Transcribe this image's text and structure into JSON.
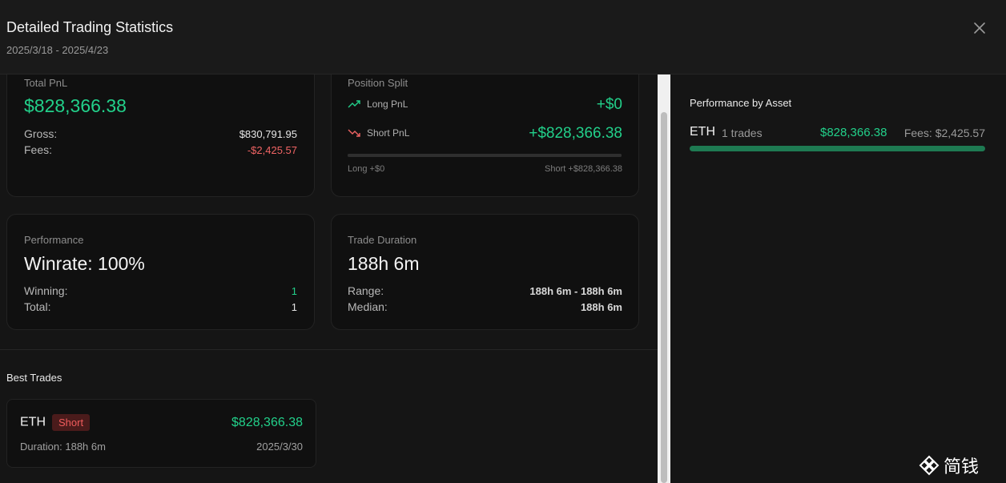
{
  "header": {
    "title": "Detailed Trading Statistics",
    "date_range": "2025/3/18 - 2025/4/23"
  },
  "total_pnl": {
    "label": "Total PnL",
    "value": "$828,366.38",
    "gross_label": "Gross:",
    "gross_value": "$830,791.95",
    "fees_label": "Fees:",
    "fees_value": "-$2,425.57"
  },
  "position_split": {
    "label": "Position Split",
    "long_label": "Long PnL",
    "long_value": "+$0",
    "short_label": "Short PnL",
    "short_value": "+$828,366.38",
    "long_foot": "Long +$0",
    "short_foot": "Short +$828,366.38",
    "short_share": 1.0
  },
  "performance": {
    "label": "Performance",
    "winrate": "Winrate: 100%",
    "winning_label": "Winning:",
    "winning_value": "1",
    "total_label": "Total:",
    "total_value": "1"
  },
  "trade_duration": {
    "label": "Trade Duration",
    "value": "188h 6m",
    "range_label": "Range:",
    "range_value": "188h 6m - 188h 6m",
    "median_label": "Median:",
    "median_value": "188h 6m"
  },
  "best_trades": {
    "title": "Best Trades",
    "items": [
      {
        "asset": "ETH",
        "side": "Short",
        "pnl": "$828,366.38",
        "duration": "Duration: 188h 6m",
        "date": "2025/3/30"
      }
    ]
  },
  "asset_performance": {
    "title": "Performance by Asset",
    "items": [
      {
        "asset": "ETH",
        "trades": "1 trades",
        "pnl": "$828,366.38",
        "fees": "Fees: $2,425.57",
        "bar_share": 1.0
      }
    ]
  },
  "watermark": {
    "text": "简钱"
  },
  "colors": {
    "positive": "#22d08a",
    "negative": "#f06464",
    "background": "#151515",
    "card": "#101010"
  }
}
